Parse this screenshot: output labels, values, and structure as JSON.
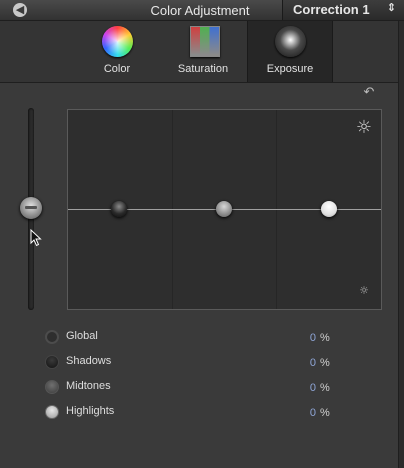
{
  "titlebar": {
    "title": "Color Adjustment",
    "correction": "Correction 1",
    "back_icon": "back-icon",
    "chevron_icon": "chevron-updown-icon"
  },
  "tabs": [
    {
      "label": "Color",
      "icon": "color-wheel-icon",
      "active": false
    },
    {
      "label": "Saturation",
      "icon": "saturation-icon",
      "active": false
    },
    {
      "label": "Exposure",
      "icon": "exposure-icon",
      "active": true
    }
  ],
  "board": {
    "reset_icon": "reset-icon",
    "bright_icon": "sun-large-icon",
    "dark_icon": "sun-small-icon"
  },
  "legend": [
    {
      "name": "Global",
      "value": "0",
      "unit": "%"
    },
    {
      "name": "Shadows",
      "value": "0",
      "unit": "%"
    },
    {
      "name": "Midtones",
      "value": "0",
      "unit": "%"
    },
    {
      "name": "Highlights",
      "value": "0",
      "unit": "%"
    }
  ],
  "colors": {
    "background": "#3a3a3a",
    "value_text": "#8fa6d8"
  }
}
